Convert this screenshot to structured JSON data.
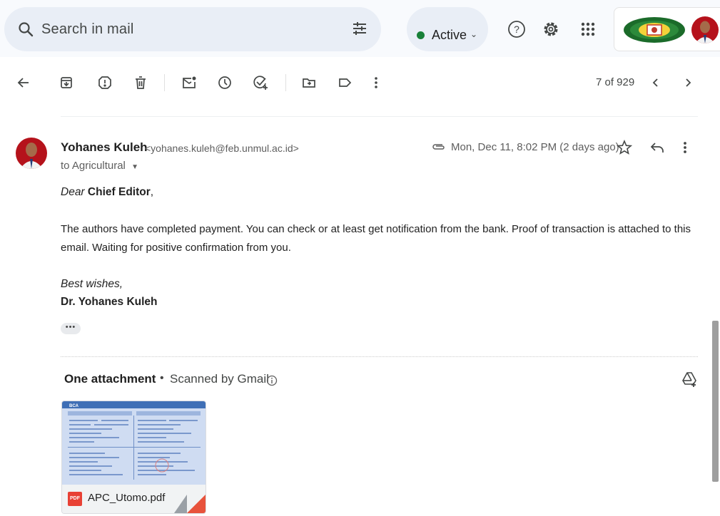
{
  "search": {
    "placeholder": "Search in mail",
    "icon": "search-icon",
    "filter_icon": "tune-icon"
  },
  "status": {
    "label": "Active",
    "color": "#188038"
  },
  "top_icons": [
    "help-icon",
    "settings-gear-icon",
    "apps-grid-icon"
  ],
  "toolbar": {
    "icons": [
      "back-arrow-icon",
      "archive-icon",
      "report-spam-icon",
      "delete-icon",
      "mark-unread-icon",
      "snooze-icon",
      "add-to-tasks-icon",
      "move-to-icon",
      "label-icon",
      "more-vert-icon"
    ],
    "pager": "7 of 929"
  },
  "message": {
    "sender_name": "Yohanes Kuleh",
    "sender_email": "<yohanes.kuleh@feb.unmul.ac.id>",
    "to": "to Agricultural",
    "datetime": "Mon, Dec 11, 8:02 PM (2 days ago)",
    "greeting_prefix": "Dear",
    "greeting_name": "Chief Editor",
    "greeting_suffix": ",",
    "paragraph_1": "The authors have completed payment. You can check or at least get notification from the bank. Proof of transaction is attached to this",
    "paragraph_2": "email. Waiting for positive confirmation from you.",
    "closing": "Best wishes,",
    "signature": "Dr. Yohanes Kuleh",
    "trimmed": "•••"
  },
  "attachments": {
    "title": "One attachment",
    "separator": "•",
    "scan_note": "Scanned by Gmail",
    "files": [
      {
        "name": "APC_Utomo.pdf",
        "type_badge": "PDF"
      }
    ]
  },
  "colors": {
    "accent_blue": "#0b57d0",
    "pdf_red": "#e84135"
  }
}
